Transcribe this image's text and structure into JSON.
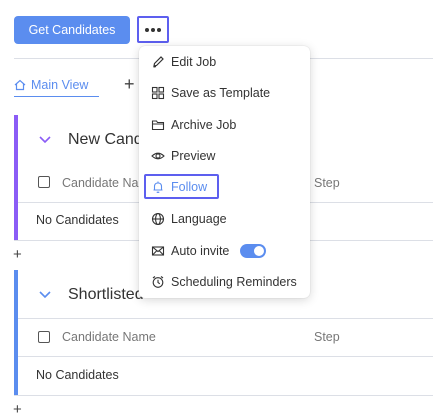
{
  "toolbar": {
    "get_candidates_label": "Get Candidates",
    "more_button": "more-options"
  },
  "views": {
    "main_view_label": "Main View",
    "add_view_symbol": "+"
  },
  "stages": [
    {
      "title": "New Cand",
      "accent": "#8b5cf6",
      "col_name": "Candidate Na",
      "col_step": "Step",
      "empty_text": "No Candidates"
    },
    {
      "title": "Shortlisted",
      "accent": "#5b8def",
      "col_name": "Candidate Name",
      "col_step": "Step",
      "empty_text": "No Candidates"
    }
  ],
  "add_stage_symbol": "+",
  "menu": {
    "items": [
      {
        "label": "Edit Job",
        "icon": "pencil-icon"
      },
      {
        "label": "Save as Template",
        "icon": "grid-icon"
      },
      {
        "label": "Archive Job",
        "icon": "folder-icon"
      },
      {
        "label": "Preview",
        "icon": "eye-icon"
      },
      {
        "label": "Follow",
        "icon": "bell-icon"
      },
      {
        "label": "Language",
        "icon": "globe-icon"
      },
      {
        "label": "Auto invite",
        "icon": "mail-icon",
        "toggle": true
      },
      {
        "label": "Scheduling Reminders",
        "icon": "alarm-icon"
      }
    ]
  },
  "colors": {
    "primary": "#5b8def",
    "highlight": "#5d5fef",
    "stage1_accent": "#8b5cf6"
  }
}
